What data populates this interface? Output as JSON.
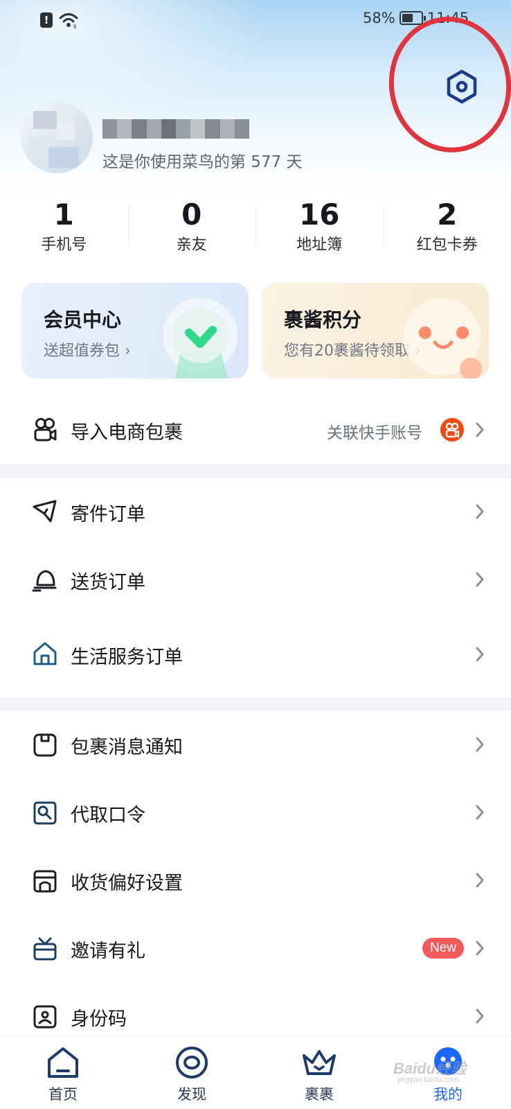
{
  "status_bar": {
    "battery_percent_text": "58%",
    "battery_level": 0.58,
    "time": "11:45",
    "icons": [
      "alert-icon",
      "wifi-icon",
      "battery-icon"
    ]
  },
  "header": {
    "settings_icon": "settings-gear-icon",
    "highlight_color": "#e0343f"
  },
  "profile": {
    "days_text": "这是你使用菜鸟的第 577 天"
  },
  "stats": [
    {
      "value": "1",
      "label": "手机号"
    },
    {
      "value": "0",
      "label": "亲友"
    },
    {
      "value": "16",
      "label": "地址簿"
    },
    {
      "value": "2",
      "label": "红包卡券"
    }
  ],
  "cards": {
    "member": {
      "title": "会员中心",
      "subtitle": "送超值券包 ›"
    },
    "points": {
      "title": "裹酱积分",
      "subtitle": "您有20裹酱待领取 ›"
    }
  },
  "import_row": {
    "label": "导入电商包裹",
    "right_text": "关联快手账号"
  },
  "orders": [
    {
      "label": "寄件订单",
      "icon": "send-paper-plane-icon"
    },
    {
      "label": "送货订单",
      "icon": "delivery-bell-icon"
    },
    {
      "label": "生活服务订单",
      "icon": "home-icon"
    }
  ],
  "settings_list": [
    {
      "label": "包裹消息通知",
      "icon": "package-notice-icon"
    },
    {
      "label": "代取口令",
      "icon": "pickup-code-icon"
    },
    {
      "label": "收货偏好设置",
      "icon": "store-icon"
    },
    {
      "label": "邀请有礼",
      "icon": "gift-icon",
      "badge": "New"
    },
    {
      "label": "身份码",
      "icon": "id-code-icon"
    }
  ],
  "tabbar": [
    {
      "label": "首页",
      "icon": "home-tab-icon"
    },
    {
      "label": "发现",
      "icon": "discover-tab-icon"
    },
    {
      "label": "裹裹",
      "icon": "guoguo-crown-tab-icon"
    },
    {
      "label": "我的",
      "icon": "my-tab-icon",
      "active": true
    }
  ],
  "colors": {
    "accent": "#1a66ff",
    "kuaishou": "#f04a12",
    "new_badge": "#f45a5a"
  },
  "watermark": {
    "text": "Baidu经验",
    "sub": "jingyan.baidu.com"
  }
}
